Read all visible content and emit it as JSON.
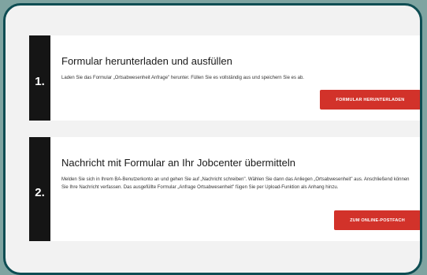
{
  "steps": [
    {
      "number": "1.",
      "title": "Formular herunterladen und ausfüllen",
      "text": "Laden Sie das Formular „Ortsabwesenheit Anfrage\" herunter. Füllen Sie es vollständig aus und speichern Sie es ab.",
      "button_label": "FORMULAR HERUNTERLADEN"
    },
    {
      "number": "2.",
      "title": "Nachricht mit Formular an Ihr Jobcenter übermitteln",
      "text": "Melden Sie sich in Ihrem BA-Benutzerkonto an und gehen Sie auf „Nachricht schreiben\". Wählen Sie dann das Anliegen „Ortsabwesenheit\" aus. Anschließend können Sie Ihre Nachricht verfassen. Das ausgefüllte Formular „Anfrage Ortsabwesenheit\" fügen Sie per Upload-Funktion als Anhang hinzu.",
      "button_label": "ZUM ONLINE-POSTFACH"
    }
  ],
  "colors": {
    "frame_border": "#0e4d53",
    "number_block": "#151515",
    "button": "#d2322a",
    "outside": "#7fa4a1"
  }
}
